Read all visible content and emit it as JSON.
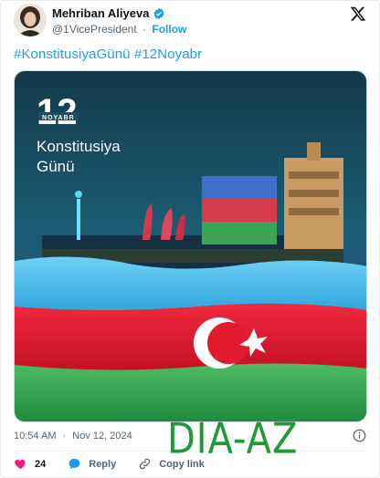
{
  "author": {
    "name": "Mehriban Aliyeva",
    "handle": "@1VicePresident",
    "separator": "·",
    "follow_label": "Follow",
    "verified": true
  },
  "tweet": {
    "hashtag_1": "#KonstitusiyaGünü",
    "hashtag_2": "#12Noyabr"
  },
  "media": {
    "day": "12",
    "month": "NOYABR",
    "title_line_1": "Konstitusiya",
    "title_line_2": "Günü"
  },
  "meta": {
    "time": "10:54 AM",
    "separator": "·",
    "date": "Nov 12, 2024"
  },
  "actions": {
    "like_count": "24",
    "reply_label": "Reply",
    "copy_label": "Copy link"
  },
  "watermark": "DIA-AZ",
  "colors": {
    "accent": "#1d9bf0",
    "like": "#f91880",
    "flag_blue": "#3ab3e6",
    "flag_red": "#e5132b",
    "flag_green": "#3aa655",
    "watermark": "#1f9a3a"
  }
}
